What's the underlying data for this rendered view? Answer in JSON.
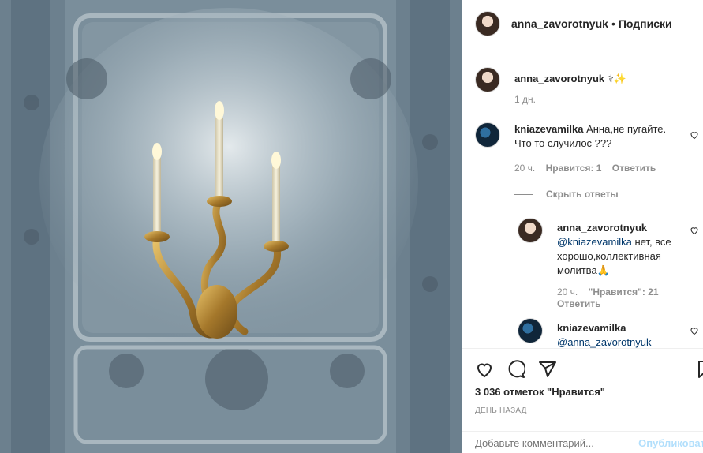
{
  "header": {
    "username": "anna_zavorotnyuk",
    "separator": "•",
    "follow_label": "Подписки"
  },
  "caption": {
    "username": "anna_zavorotnyuk",
    "emoji": "⚕✨",
    "time": "1 дн."
  },
  "comments": [
    {
      "username": "kniazevamilka",
      "text": "Анна,не пугайте. Что то случилос ???",
      "time": "20 ч.",
      "likes": "Нравится: 1",
      "reply": "Ответить"
    }
  ],
  "hide_replies": "Скрыть ответы",
  "replies": [
    {
      "username": "anna_zavorotnyuk",
      "mention": "@kniazevamilka",
      "text": " нет, все хорошо,коллективная молитва🙏",
      "time": "20 ч.",
      "likes": "\"Нравится\": 21",
      "reply": "Ответить"
    },
    {
      "username": "kniazevamilka",
      "mention": "@anna_zavorotnyuk",
      "text": ""
    }
  ],
  "likes_count": "3 036 отметок \"Нравится\"",
  "date_label": "ДЕНЬ НАЗАД",
  "comment_input": {
    "placeholder": "Добавьте комментарий...",
    "post_label": "Опубликовать"
  },
  "icons": [
    "heart-icon",
    "comment-icon",
    "share-icon",
    "bookmark-icon"
  ]
}
